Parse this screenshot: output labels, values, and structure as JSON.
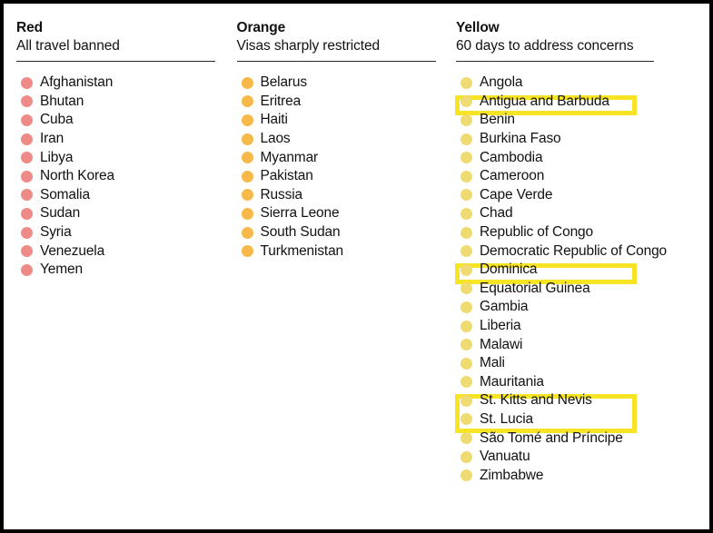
{
  "colors": {
    "red_dot": "#EE8B88",
    "orange_dot": "#F5B košer",
    "orange_dot_hex": "#F6B košer",
    "frame_border": "#000000",
    "rule": "#2a2a2a",
    "highlight": "#F7E425",
    "text": "#121212"
  },
  "columns": [
    {
      "id": "red",
      "title": "Red",
      "subtitle": "All travel banned",
      "dot_color": "#EE8B88",
      "items": [
        {
          "name": "Afghanistan",
          "highlighted": false
        },
        {
          "name": "Bhutan",
          "highlighted": false
        },
        {
          "name": "Cuba",
          "highlighted": false
        },
        {
          "name": "Iran",
          "highlighted": false
        },
        {
          "name": "Libya",
          "highlighted": false
        },
        {
          "name": "North Korea",
          "highlighted": false
        },
        {
          "name": "Somalia",
          "highlighted": false
        },
        {
          "name": "Sudan",
          "highlighted": false
        },
        {
          "name": "Syria",
          "highlighted": false
        },
        {
          "name": "Venezuela",
          "highlighted": false
        },
        {
          "name": "Yemen",
          "highlighted": false
        }
      ]
    },
    {
      "id": "orange",
      "title": "Orange",
      "subtitle": "Visas sharply restricted",
      "dot_color": "#F6B94A",
      "items": [
        {
          "name": "Belarus",
          "highlighted": false
        },
        {
          "name": "Eritrea",
          "highlighted": false
        },
        {
          "name": "Haiti",
          "highlighted": false
        },
        {
          "name": "Laos",
          "highlighted": false
        },
        {
          "name": "Myanmar",
          "highlighted": false
        },
        {
          "name": "Pakistan",
          "highlighted": false
        },
        {
          "name": "Russia",
          "highlighted": false
        },
        {
          "name": "Sierra Leone",
          "highlighted": false
        },
        {
          "name": "South Sudan",
          "highlighted": false
        },
        {
          "name": "Turkmenistan",
          "highlighted": false
        }
      ]
    },
    {
      "id": "yellow",
      "title": "Yellow",
      "subtitle": "60 days to address concerns",
      "dot_color": "#EEDC72",
      "items": [
        {
          "name": "Angola",
          "highlighted": false
        },
        {
          "name": "Antigua and Barbuda",
          "highlighted": true
        },
        {
          "name": "Benin",
          "highlighted": false
        },
        {
          "name": "Burkina Faso",
          "highlighted": false
        },
        {
          "name": "Cambodia",
          "highlighted": false
        },
        {
          "name": "Cameroon",
          "highlighted": false
        },
        {
          "name": "Cape Verde",
          "highlighted": false
        },
        {
          "name": "Chad",
          "highlighted": false
        },
        {
          "name": "Republic of Congo",
          "highlighted": false
        },
        {
          "name": "Democratic Republic of Congo",
          "highlighted": false
        },
        {
          "name": "Dominica",
          "highlighted": true
        },
        {
          "name": "Equatorial Guinea",
          "highlighted": false
        },
        {
          "name": "Gambia",
          "highlighted": false
        },
        {
          "name": "Liberia",
          "highlighted": false
        },
        {
          "name": "Malawi",
          "highlighted": false
        },
        {
          "name": "Mali",
          "highlighted": false
        },
        {
          "name": "Mauritania",
          "highlighted": false
        },
        {
          "name": "St. Kitts and Nevis",
          "highlighted": true
        },
        {
          "name": "St. Lucia",
          "highlighted": true
        },
        {
          "name": "São Tomé and Príncipe",
          "highlighted": false
        },
        {
          "name": "Vanuatu",
          "highlighted": false
        },
        {
          "name": "Zimbabwe",
          "highlighted": false
        }
      ],
      "highlight_groups": [
        {
          "label": "Antigua and Barbuda",
          "start_index": 1,
          "end_index": 1
        },
        {
          "label": "Dominica",
          "start_index": 10,
          "end_index": 10
        },
        {
          "label": "St. Kitts and Nevis / St. Lucia",
          "start_index": 17,
          "end_index": 18
        }
      ]
    }
  ]
}
